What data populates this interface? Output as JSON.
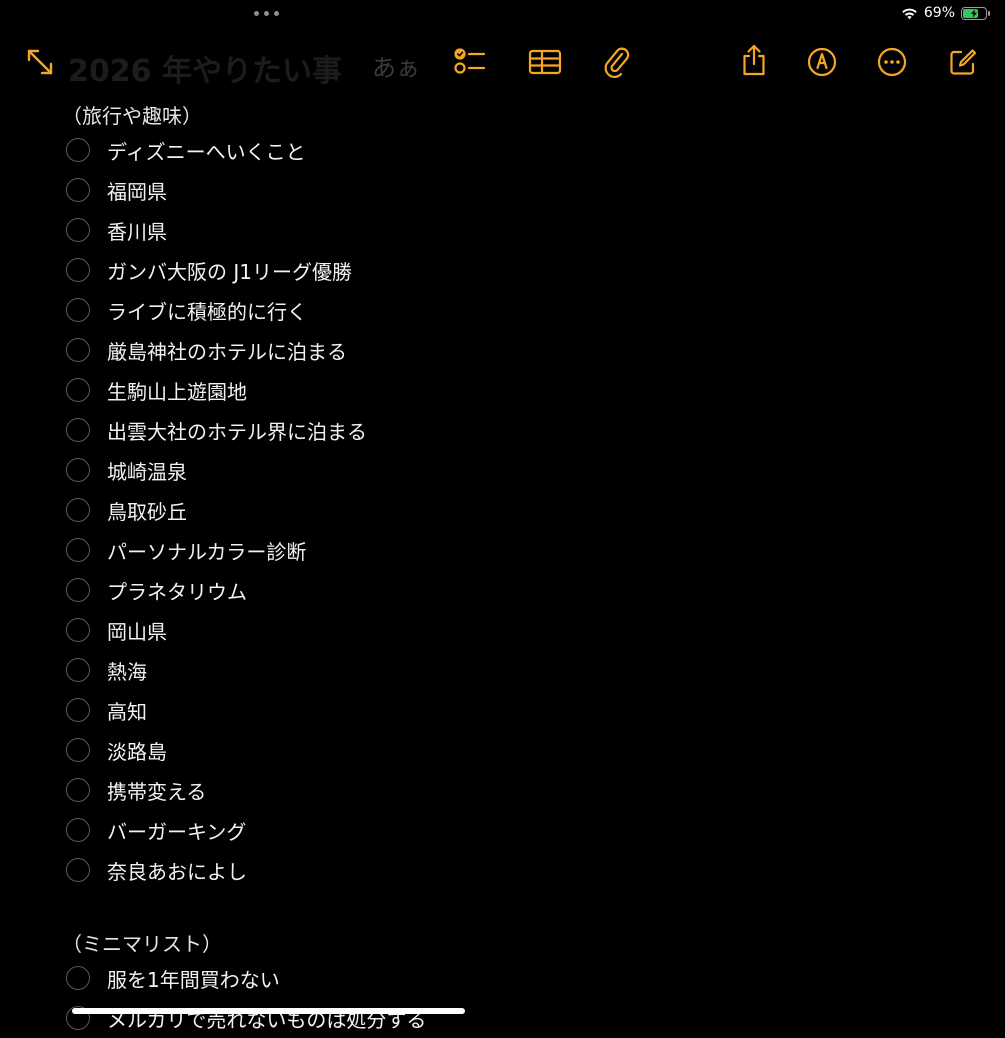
{
  "status_bar": {
    "time_text": "",
    "battery_percent_text": "69%",
    "battery_level": 0.69,
    "battery_color": "#34c759",
    "icons": [
      "multitask-dots-icon",
      "wifi-icon",
      "battery-charging-icon"
    ]
  },
  "toolbar": {
    "accent_color": "#f5a623",
    "note_title": "2026 年やりたい事",
    "format_label": "あぁ",
    "buttons": [
      "expand-icon",
      "checklist-icon",
      "table-icon",
      "attachment-icon",
      "share-icon",
      "markup-icon",
      "more-icon",
      "compose-icon"
    ]
  },
  "sections": [
    {
      "heading": "（旅行や趣味）",
      "items": [
        "ディズニーへいくこと",
        "福岡県",
        "香川県",
        "ガンバ大阪の J1リーグ優勝",
        "ライブに積極的に行く",
        "厳島神社のホテルに泊まる",
        "生駒山上遊園地",
        "出雲大社のホテル界に泊まる",
        "城崎温泉",
        "鳥取砂丘",
        "パーソナルカラー診断",
        "プラネタリウム",
        "岡山県",
        "熱海",
        "高知",
        "淡路島",
        "携帯変える",
        "バーガーキング",
        "奈良あおによし"
      ]
    },
    {
      "heading": "（ミニマリスト）",
      "items": [
        "服を1年間買わない",
        "メルカリで売れないものは処分する"
      ]
    }
  ]
}
